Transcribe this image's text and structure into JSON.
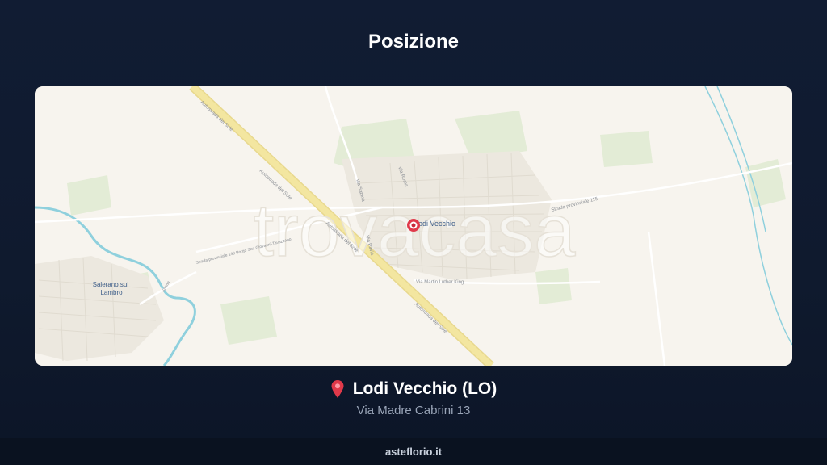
{
  "header": {
    "title": "Posizione"
  },
  "map": {
    "watermark": "trovacasa",
    "labels": {
      "town_main": "Lodi Vecchio",
      "town_secondary": "Salerano sul Lambro",
      "highway_a": "Autostrada del Sole",
      "highway_b": "Autostrada del Sole",
      "highway_c": "Autostrada del Sole",
      "highway_d": "Autostrada del Sole",
      "road_sp115": "Strada provinciale 115",
      "road_sp140": "Strada provinciale 140 Borgo San Giovanni-Tavazzano",
      "road_luther": "Via Martin Luther King",
      "road_sabina": "Via Sabina",
      "road_roma": "Via Roma",
      "road_pavia": "Via Pavia",
      "road_gn": "Strada"
    }
  },
  "location": {
    "name": "Lodi Vecchio (LO)",
    "address": "Via Madre Cabrini 13"
  },
  "footer": {
    "site": "asteflorio.it"
  },
  "colors": {
    "background": "#111c33",
    "map_base": "#f7f4ee",
    "highway": "#f3e6a0",
    "water": "#8fd0dd",
    "pin": "#e0394a"
  }
}
